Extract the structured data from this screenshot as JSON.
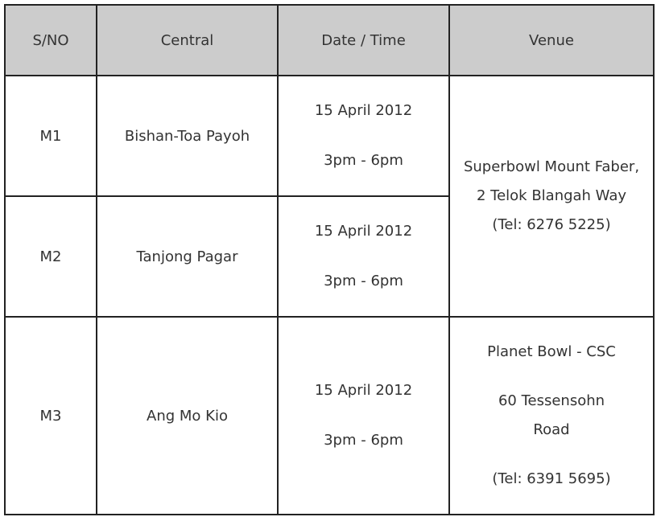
{
  "table": {
    "headers": [
      "S/NO",
      "Central",
      "Date / Time",
      "Venue"
    ],
    "rows": [
      {
        "sno": "M1",
        "central": "Bishan-Toa Payoh",
        "date": "15 April 2012",
        "time": "3pm - 6pm"
      },
      {
        "sno": "M2",
        "central": "Tanjong Pagar",
        "date": "15 April 2012",
        "time": "3pm - 6pm"
      },
      {
        "sno": "M3",
        "central": "Ang Mo Kio",
        "date": "15 April 2012",
        "time": "3pm - 6pm"
      }
    ],
    "venues": [
      {
        "text": "Superbowl Mount Faber, 2 Telok Blangah Way (Tel: 6276 5225)"
      },
      {
        "name": "Planet Bowl - CSC",
        "address": "60 Tessensohn Road",
        "tel": "(Tel: 6391 5695)"
      }
    ]
  }
}
